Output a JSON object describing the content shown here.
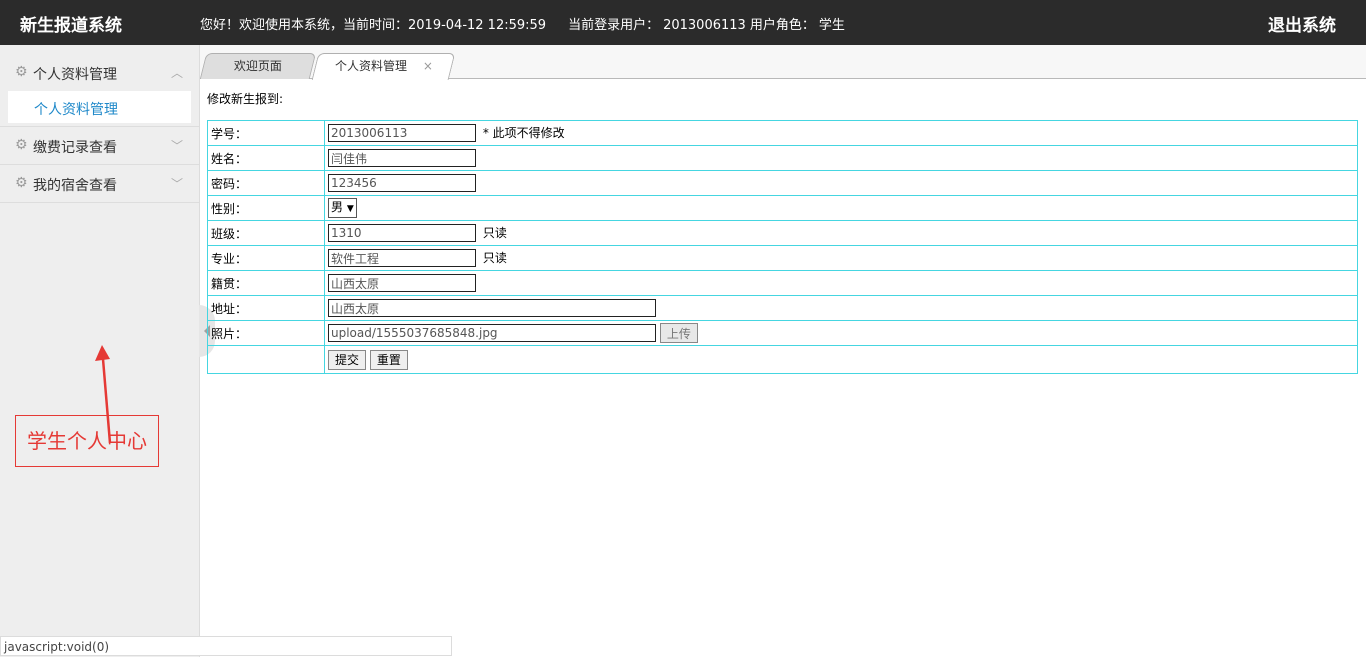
{
  "header": {
    "app_title": "新生报道系统",
    "greeting": "您好！欢迎使用本系统，当前时间：2019-04-12 12:59:59",
    "current_user_label": "当前登录用户：",
    "current_user": "2013006113",
    "role_label": "用户角色：",
    "role": "学生",
    "logout_label": "退出系统"
  },
  "sidebar": {
    "groups": [
      {
        "label": "个人资料管理",
        "icon": "gear-icon",
        "chevron": "up",
        "items": [
          {
            "label": "个人资料管理"
          }
        ]
      },
      {
        "label": "缴费记录查看",
        "icon": "gear-icon",
        "chevron": "down"
      },
      {
        "label": "我的宿舍查看",
        "icon": "gear-icon",
        "chevron": "down"
      }
    ]
  },
  "annotation": {
    "text": "学生个人中心",
    "color": "#e53935"
  },
  "tabs": [
    {
      "label": "欢迎页面"
    },
    {
      "label": "个人资料管理",
      "close": "×"
    }
  ],
  "form": {
    "title": "修改新生报到:",
    "rows": {
      "student_id": {
        "label": "学号：",
        "value": "2013006113",
        "note": "* 此项不得修改"
      },
      "name": {
        "label": "姓名：",
        "value": "闫佳伟"
      },
      "password": {
        "label": "密码：",
        "value": "123456"
      },
      "gender": {
        "label": "性别：",
        "value": "男"
      },
      "class": {
        "label": "班级：",
        "value": "1310",
        "note": "只读"
      },
      "major": {
        "label": "专业：",
        "value": "软件工程",
        "note": "只读"
      },
      "hometown": {
        "label": "籍贯：",
        "value": "山西太原"
      },
      "address": {
        "label": "地址：",
        "value": "山西太原"
      },
      "photo": {
        "label": "照片：",
        "value": "upload/1555037685848.jpg",
        "upload_label": "上传"
      }
    },
    "submit_label": "提交",
    "reset_label": "重置"
  },
  "statusbar": {
    "text": "javascript:void(0)"
  }
}
